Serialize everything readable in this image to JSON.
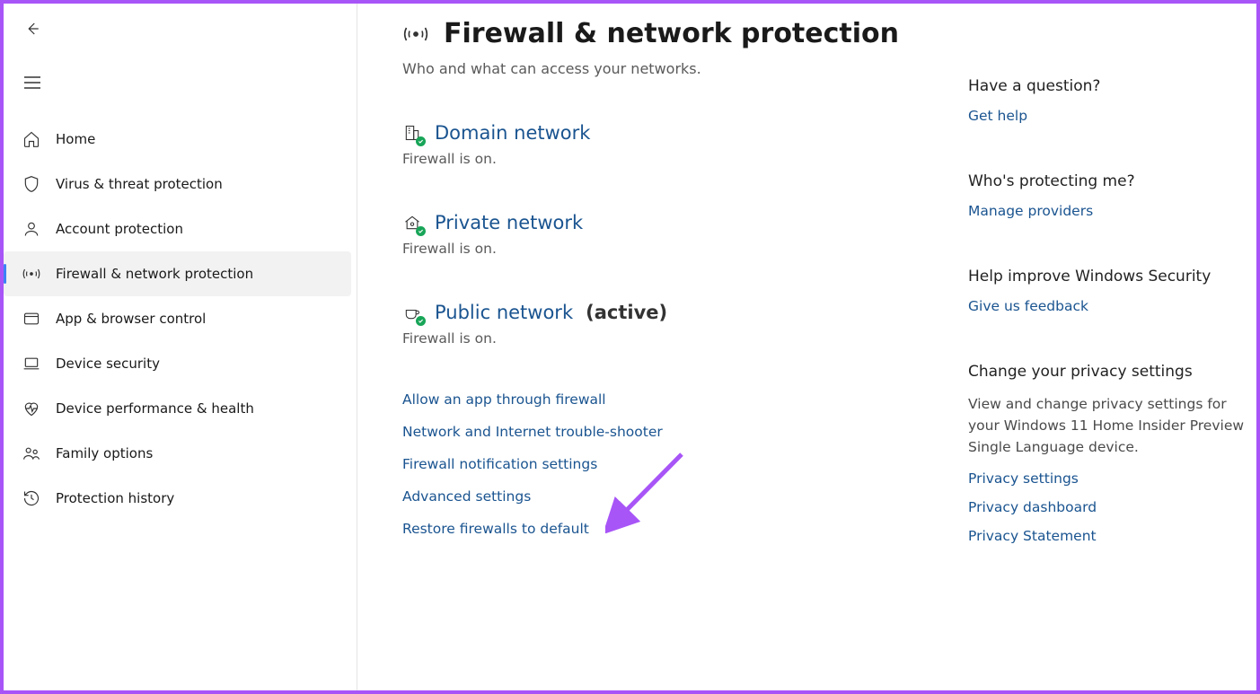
{
  "sidebar": {
    "items": [
      {
        "label": "Home"
      },
      {
        "label": "Virus & threat protection"
      },
      {
        "label": "Account protection"
      },
      {
        "label": "Firewall & network protection"
      },
      {
        "label": "App & browser control"
      },
      {
        "label": "Device security"
      },
      {
        "label": "Device performance & health"
      },
      {
        "label": "Family options"
      },
      {
        "label": "Protection history"
      }
    ]
  },
  "page": {
    "title": "Firewall & network protection",
    "subtitle": "Who and what can access your networks."
  },
  "networks": [
    {
      "name": "Domain network",
      "status": "Firewall is on.",
      "active": ""
    },
    {
      "name": "Private network",
      "status": "Firewall is on.",
      "active": ""
    },
    {
      "name": "Public network",
      "status": "Firewall is on.",
      "active": "(active)"
    }
  ],
  "actions": [
    "Allow an app through firewall",
    "Network and Internet trouble-shooter",
    "Firewall notification settings",
    "Advanced settings",
    "Restore firewalls to default"
  ],
  "rail": {
    "question_title": "Have a question?",
    "get_help": "Get help",
    "protect_title": "Who's protecting me?",
    "manage_providers": "Manage providers",
    "improve_title": "Help improve Windows Security",
    "feedback": "Give us feedback",
    "privacy_title": "Change your privacy settings",
    "privacy_text": "View and change privacy settings for your Windows 11 Home Insider Preview Single Language device.",
    "privacy_links": [
      "Privacy settings",
      "Privacy dashboard",
      "Privacy Statement"
    ]
  }
}
